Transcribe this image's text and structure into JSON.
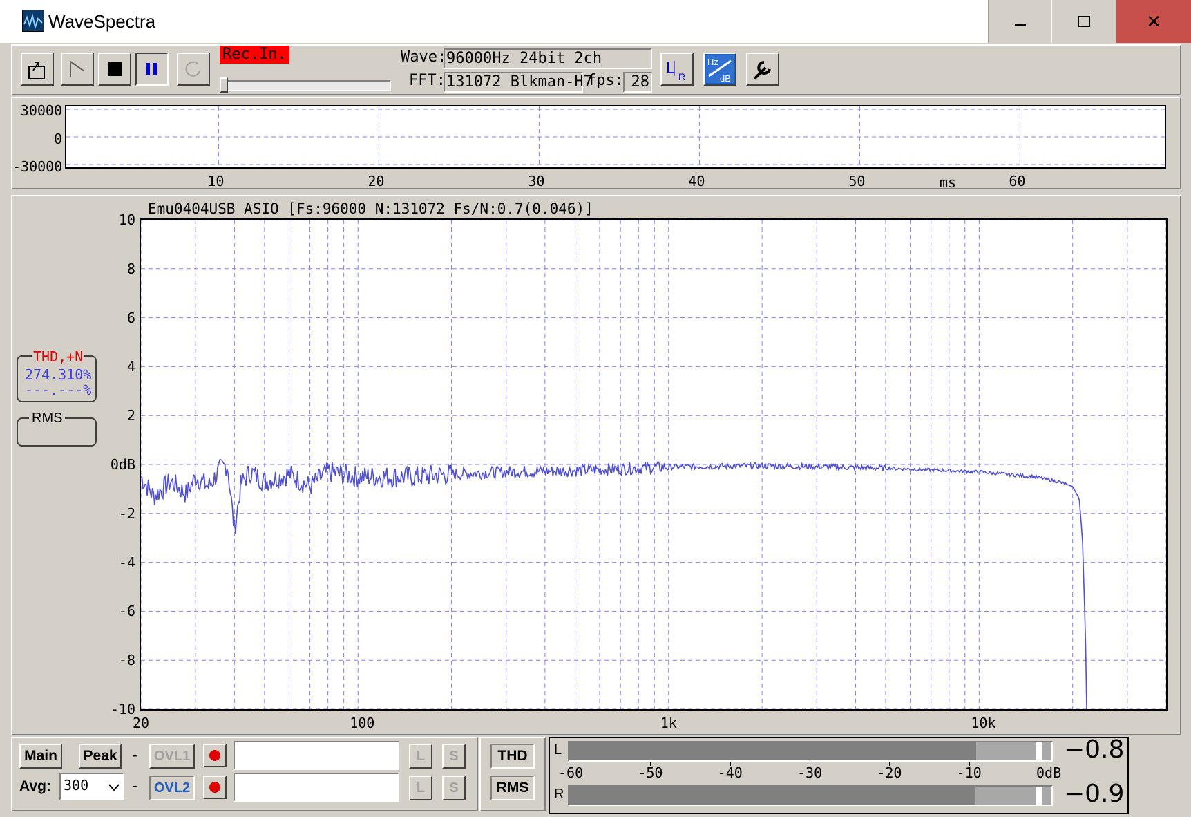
{
  "window": {
    "title": "WaveSpectra",
    "minimize": "‒",
    "maximize": "☐",
    "close": "✕"
  },
  "toolbar": {
    "rec_label": "Rec.In.",
    "wave_label": "Wave:",
    "wave_value": "96000Hz 24bit 2ch",
    "fft_label": "FFT:",
    "fft_value": "131072 Blkman-H7",
    "fps_label": "fps:",
    "fps_value": "28",
    "lr_icon_text": "L R",
    "hzdb_icon_top": "Hz",
    "hzdb_icon_bottom": "dB"
  },
  "waveform": {
    "y_ticks": [
      "30000",
      "0",
      "-30000"
    ],
    "x_ticks": [
      "10",
      "20",
      "30",
      "40",
      "50",
      "60"
    ],
    "x_unit": "ms"
  },
  "spectrum": {
    "header": "Emu0404USB ASIO   [Fs:96000  N:131072  Fs/N:0.7(0.046)]",
    "y_ticks": [
      "10",
      "8",
      "6",
      "4",
      "2",
      "0dB",
      "-2",
      "-4",
      "-6",
      "-8",
      "-10"
    ],
    "x_ticks": [
      "20",
      "100",
      "1k",
      "10k"
    ]
  },
  "thd": {
    "label": "THD,+N",
    "value1": "274.310%",
    "value2": "---.---%"
  },
  "rms": {
    "label": "RMS"
  },
  "bottom": {
    "main": "Main",
    "peak": "Peak",
    "dash1": "-",
    "dash2": "-",
    "ovl1": "OVL1",
    "ovl2": "OVL2",
    "avg_label": "Avg:",
    "avg_value": "300",
    "l": "L",
    "s": "S",
    "thd": "THD",
    "rms": "RMS"
  },
  "meter": {
    "l_label": "L",
    "r_label": "R",
    "scale": [
      "-60",
      "-50",
      "-40",
      "-30",
      "-20",
      "-10",
      "0dB"
    ],
    "l_value": "−0.8",
    "r_value": "−0.9",
    "l_level_db": -0.8,
    "r_level_db": -0.9
  },
  "chart_data": {
    "type": "line",
    "title": "Emu0404USB ASIO   [Fs:96000  N:131072  Fs/N:0.7(0.046)]",
    "x_scale": "log",
    "xlim": [
      20,
      40000
    ],
    "ylim": [
      -10,
      10
    ],
    "grid": true,
    "series": [
      {
        "x": [
          20,
          22,
          25,
          28,
          30,
          33,
          36,
          38,
          40,
          42,
          45,
          50,
          60,
          70,
          80,
          100,
          150,
          200,
          300,
          500,
          1000,
          2000,
          5000,
          10000,
          15000,
          18000,
          20000,
          21000,
          21500,
          22000,
          22200
        ],
        "y": [
          -0.5,
          -1.3,
          -0.7,
          -1.2,
          -0.5,
          -0.9,
          -0.2,
          0.0,
          -2.7,
          -0.8,
          -0.3,
          -0.7,
          -0.4,
          -0.9,
          -0.3,
          -0.5,
          -0.5,
          -0.4,
          -0.3,
          -0.25,
          -0.1,
          -0.05,
          -0.15,
          -0.3,
          -0.5,
          -0.7,
          -0.9,
          -1.4,
          -3.0,
          -7.0,
          -10.0
        ],
        "color": "#5050d0"
      }
    ]
  },
  "colors": {
    "grid": "#8080ff",
    "trace": "#5050d0",
    "face": "#d4d0c8",
    "rec_bg": "#ff0000",
    "close_bg": "#c8504a"
  }
}
